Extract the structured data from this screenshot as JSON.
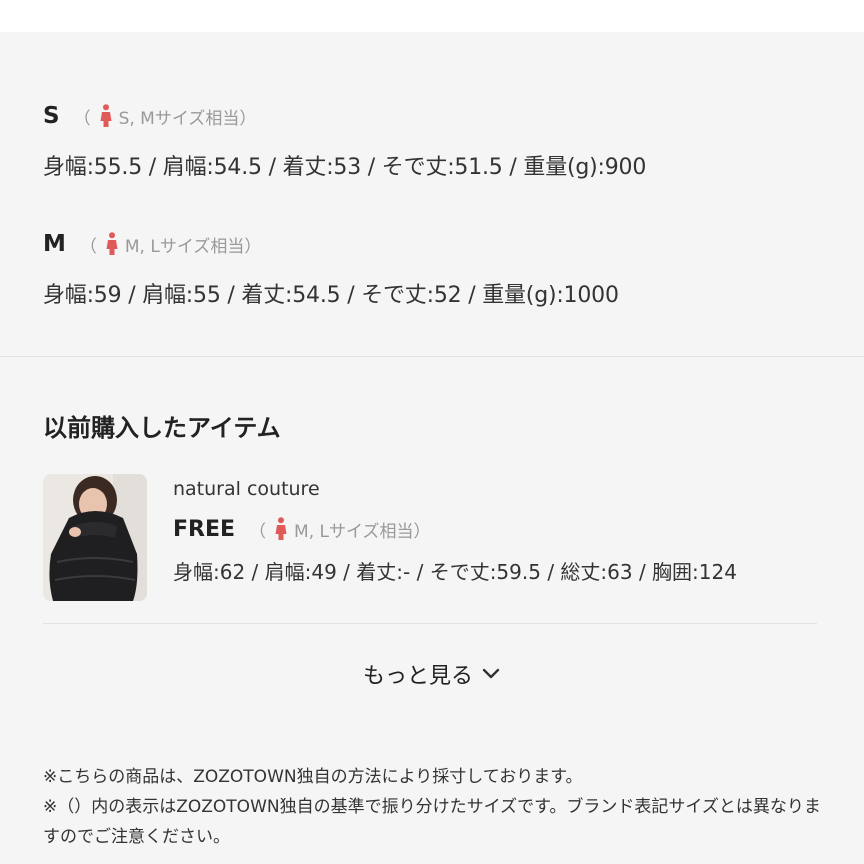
{
  "sizes": [
    {
      "name": "S",
      "paren_open": "（",
      "equiv": "S, Mサイズ相当",
      "paren_close": "）",
      "measurements": "身幅:55.5 / 肩幅:54.5 / 着丈:53 / そで丈:51.5 / 重量(g):900"
    },
    {
      "name": "M",
      "paren_open": "（",
      "equiv": "M, Lサイズ相当",
      "paren_close": "）",
      "measurements": "身幅:59 / 肩幅:55 / 着丈:54.5 / そで丈:52 / 重量(g):1000"
    }
  ],
  "previous": {
    "title": "以前購入したアイテム",
    "item": {
      "brand": "natural couture",
      "size": "FREE",
      "paren_open": "（",
      "equiv": "M, Lサイズ相当",
      "paren_close": "）",
      "measurements": "身幅:62 / 肩幅:49 / 着丈:- / そで丈:59.5 / 総丈:63 / 胸囲:124"
    }
  },
  "more": {
    "label": "もっと見る",
    "icon": "chevron-down-icon"
  },
  "notes": [
    "※こちらの商品は、ZOZOTOWN独自の方法により採寸しております。",
    "※（）内の表示はZOZOTOWN独自の基準で振り分けたサイズです。ブランド表記サイズとは異なりますのでご注意ください。"
  ],
  "colors": {
    "accent_person": "#e05a5a",
    "panel_bg": "#f5f5f5"
  }
}
